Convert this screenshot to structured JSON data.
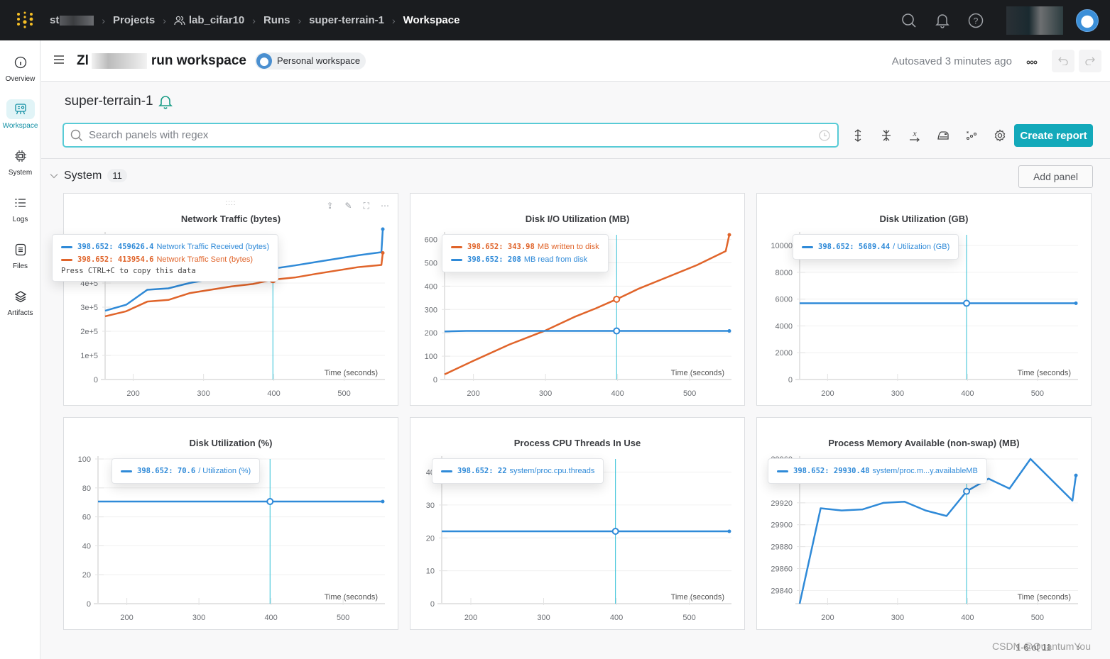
{
  "topbar": {
    "breadcrumbs": [
      {
        "label": "st"
      },
      {
        "label": "Projects"
      },
      {
        "label": "lab_cifar10"
      },
      {
        "label": "Runs"
      },
      {
        "label": "super-terrain-1"
      },
      {
        "label": "Workspace"
      }
    ]
  },
  "sidebar": {
    "items": [
      {
        "label": "Overview",
        "icon": "info-icon"
      },
      {
        "label": "Workspace",
        "icon": "workspace-icon",
        "active": true
      },
      {
        "label": "System",
        "icon": "chip-icon"
      },
      {
        "label": "Logs",
        "icon": "list-icon"
      },
      {
        "label": "Files",
        "icon": "file-icon"
      },
      {
        "label": "Artifacts",
        "icon": "layers-icon"
      }
    ]
  },
  "header": {
    "title_prefix": "Zl",
    "title_suffix": "run workspace",
    "workspace_badge": "Personal workspace",
    "autosaved": "Autosaved 3 minutes ago"
  },
  "run": {
    "name": "super-terrain-1"
  },
  "search": {
    "placeholder": "Search panels with regex",
    "value": ""
  },
  "toolbar": {
    "create_report": "Create report"
  },
  "section": {
    "name": "System",
    "count": "11",
    "add_panel": "Add panel"
  },
  "pagination": {
    "label": "1-6 of 11"
  },
  "watermark": "CSDN @QuantumYou",
  "colors": {
    "blue": "#2f8ad8",
    "orange": "#e0642a",
    "accent": "#13a9ba",
    "cursor": "#2fc0d6"
  },
  "hover_x": 398.652,
  "chart_data": [
    {
      "type": "line",
      "title": "Network Traffic (bytes)",
      "xlabel": "Time (seconds)",
      "xlim": [
        160,
        558
      ],
      "ylim": [
        0,
        600000
      ],
      "xticks": [
        200,
        300,
        400,
        500
      ],
      "yticks": [
        0,
        100000,
        200000,
        300000,
        400000
      ],
      "ytick_labels": [
        "0",
        "1e+5",
        "2e+5",
        "3e+5",
        "4e+5"
      ],
      "series": [
        {
          "name": "Network Traffic Received (bytes)",
          "color": "blue",
          "x": [
            160,
            190,
            220,
            250,
            280,
            310,
            340,
            370,
            398.652,
            430,
            460,
            490,
            520,
            553,
            555
          ],
          "y": [
            285000,
            310000,
            372000,
            378000,
            400000,
            416000,
            430000,
            445000,
            459626.4,
            473000,
            487000,
            501000,
            515000,
            528000,
            680000
          ],
          "tooltip_value": "459626.4"
        },
        {
          "name": "Network Traffic Sent (bytes)",
          "color": "orange",
          "x": [
            160,
            190,
            220,
            250,
            280,
            310,
            340,
            370,
            398.652,
            430,
            460,
            490,
            520,
            553,
            555
          ],
          "y": [
            262000,
            283000,
            323000,
            330000,
            358000,
            372000,
            386000,
            396000,
            413954.6,
            423000,
            438000,
            452000,
            466000,
            475000,
            525000
          ],
          "tooltip_value": "413954.6"
        }
      ],
      "tooltip_hint": "Press CTRL+C to copy this data"
    },
    {
      "type": "line",
      "title": "Disk I/O Utilization (MB)",
      "xlabel": "Time (seconds)",
      "xlim": [
        160,
        558
      ],
      "ylim": [
        0,
        620
      ],
      "xticks": [
        200,
        300,
        400,
        500
      ],
      "yticks": [
        0,
        100,
        200,
        300,
        400,
        500,
        600
      ],
      "ytick_labels": [
        "0",
        "100",
        "200",
        "300",
        "400",
        "500",
        "600"
      ],
      "series": [
        {
          "name": "MB written to disk",
          "color": "orange",
          "x": [
            160,
            200,
            250,
            300,
            340,
            370,
            398.652,
            430,
            470,
            510,
            550,
            555
          ],
          "y": [
            22,
            80,
            150,
            210,
            268,
            305,
            343.98,
            390,
            440,
            490,
            550,
            620
          ],
          "tooltip_value": "343.98"
        },
        {
          "name": "MB read from disk",
          "color": "blue",
          "x": [
            160,
            190,
            398.652,
            555
          ],
          "y": [
            206,
            208,
            208,
            208
          ],
          "tooltip_value": "208"
        }
      ]
    },
    {
      "type": "line",
      "title": "Disk Utilization (GB)",
      "xlabel": "Time (seconds)",
      "xlim": [
        160,
        558
      ],
      "ylim": [
        0,
        10800
      ],
      "xticks": [
        200,
        300,
        400,
        500
      ],
      "yticks": [
        0,
        2000,
        4000,
        6000,
        8000,
        10000
      ],
      "ytick_labels": [
        "0",
        "2000",
        "4000",
        "6000",
        "8000",
        "10000"
      ],
      "series": [
        {
          "name": "/ Utilization (GB)",
          "color": "blue",
          "x": [
            160,
            398.652,
            555
          ],
          "y": [
            5689.44,
            5689.44,
            5689.44
          ],
          "tooltip_value": "5689.44"
        }
      ]
    },
    {
      "type": "line",
      "title": "Disk Utilization (%)",
      "xlabel": "Time (seconds)",
      "xlim": [
        160,
        558
      ],
      "ylim": [
        0,
        100
      ],
      "xticks": [
        200,
        300,
        400,
        500
      ],
      "yticks": [
        0,
        20,
        40,
        60,
        80,
        100
      ],
      "ytick_labels": [
        "0",
        "20",
        "40",
        "60",
        "80",
        "100"
      ],
      "series": [
        {
          "name": "/ Utilization (%)",
          "color": "blue",
          "x": [
            160,
            398.652,
            555
          ],
          "y": [
            70.6,
            70.6,
            70.6
          ],
          "tooltip_value": "70.6"
        }
      ]
    },
    {
      "type": "line",
      "title": "Process CPU Threads In Use",
      "xlabel": "Time (seconds)",
      "xlim": [
        160,
        558
      ],
      "ylim": [
        0,
        44
      ],
      "xticks": [
        200,
        300,
        400,
        500
      ],
      "yticks": [
        0,
        10,
        20,
        30,
        40
      ],
      "ytick_labels": [
        "0",
        "10",
        "20",
        "30",
        "40"
      ],
      "series": [
        {
          "name": "system/proc.cpu.threads",
          "color": "blue",
          "x": [
            160,
            398.652,
            555
          ],
          "y": [
            22,
            22,
            22
          ],
          "tooltip_value": "22"
        }
      ]
    },
    {
      "type": "line",
      "title": "Process Memory Available (non-swap) (MB)",
      "xlabel": "Time (seconds)",
      "xlim": [
        160,
        558
      ],
      "ylim": [
        29828,
        29960
      ],
      "xticks": [
        200,
        300,
        400,
        500
      ],
      "yticks": [
        29840,
        29860,
        29880,
        29900,
        29920,
        29960
      ],
      "ytick_labels": [
        "29840",
        "29860",
        "29880",
        "29900",
        "29920",
        "29960"
      ],
      "series": [
        {
          "name": "system/proc.m...y.availableMB",
          "color": "blue",
          "x": [
            160,
            190,
            220,
            250,
            280,
            310,
            340,
            370,
            398.652,
            430,
            460,
            490,
            550,
            555
          ],
          "y": [
            29828,
            29915,
            29913,
            29914,
            29920,
            29921,
            29913,
            29908,
            29930.48,
            29942,
            29933,
            29960,
            29922,
            29945
          ],
          "tooltip_value": "29930.48"
        }
      ]
    }
  ]
}
